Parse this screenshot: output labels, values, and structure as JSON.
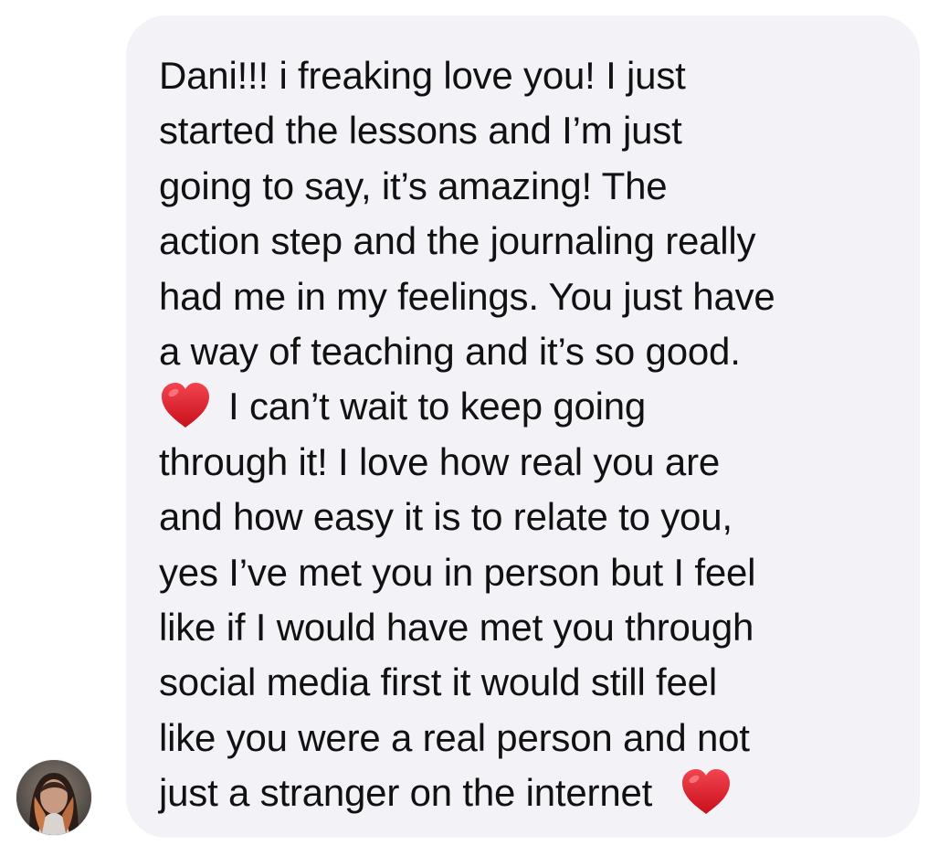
{
  "conversation": {
    "message": {
      "sender_avatar": "avatar-photo",
      "bubble_color": "#f2f2f7",
      "text_color": "#111111",
      "lines": {
        "l0": "Dani!!! i freaking love you! I just",
        "l1": "started the lessons and I’m just",
        "l2": "going to say, it’s amazing! The",
        "l3": "action step and the journaling really",
        "l4": "had me in my feelings. You just have",
        "l5": "a way of teaching and it’s so good.",
        "l6": "I can’t wait to keep going",
        "l7": "through it! I love how real you are",
        "l8": "and how easy it is to relate to you,",
        "l9": "yes I’ve met you in person but I feel",
        "l10": "like if I would have met you through",
        "l11": "social media first it would still feel",
        "l12": "like you were a real person and not",
        "l13": "just a stranger on the internet"
      },
      "emoji": {
        "heart_1": "red-heart",
        "heart_2": "red-heart",
        "heart_color": "#e0202e"
      }
    }
  }
}
